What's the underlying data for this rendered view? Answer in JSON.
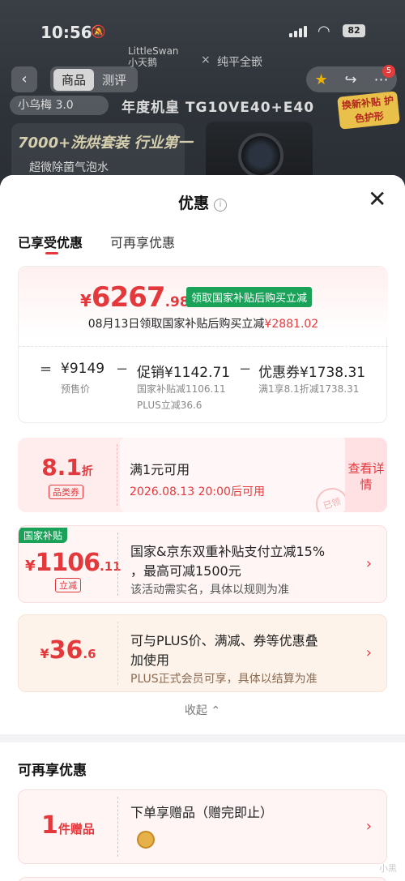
{
  "status_bar": {
    "time": "10:56",
    "battery": "82"
  },
  "background_page": {
    "brand_left": "LittleSwan",
    "brand_left_cn": "小天鹅",
    "brand_x": "×",
    "brand_right": "纯平全嵌",
    "tabs": [
      "商品",
      "测评"
    ],
    "cart_badge": "5",
    "series_tag": "小乌梅 3.0",
    "model_text": "年度机皇 TG10VE40+E40",
    "promo_tag": "换新补贴 护色护形",
    "banner_line1": "7000+洗烘套装 行业第一",
    "banner_line2": "超微除菌气泡水"
  },
  "sheet": {
    "title": "优惠",
    "tabs": [
      "已享受优惠",
      "可再享优惠"
    ],
    "summary": {
      "currency": "¥",
      "price_int": "6267",
      "price_dec": ".98",
      "badge": "领取国家补贴后购买立减",
      "subtitle_prefix": "08月13日领取国家补贴后购买立减",
      "subtitle_amount": "¥2881.02",
      "eq": "=",
      "presale_price": "¥9149",
      "presale_label": "预售价",
      "minus": "−",
      "promo_label_value": "促销¥1142.71",
      "promo_sub1": "国家补贴减1106.11",
      "promo_sub2": "PLUS立减36.6",
      "coupon_label_value": "优惠券¥1738.31",
      "coupon_sub": "满1享8.1折减1738.31"
    },
    "coupon_card": {
      "big": "8.1",
      "big_suffix": "折",
      "tag": "品类券",
      "condition": "满1元可用",
      "time": "2026.08.13 20:00后可用",
      "view_label": "查看详情",
      "stamp": "已领"
    },
    "subsidy_card": {
      "badge": "国家补贴",
      "currency": "¥",
      "amount_int": "1106",
      "amount_dec": ".11",
      "tag": "立减",
      "line1": "国家&京东双重补贴支付立减15%",
      "line2": "，最高可减1500元",
      "line3": "该活动需实名，具体以规则为准"
    },
    "plus_card": {
      "currency": "¥",
      "amount_int": "36",
      "amount_dec": ".6",
      "line1": "可与PLUS价、满减、券等优惠叠",
      "line2": "加使用",
      "line3": "PLUS正式会员可享，具体以结算为准"
    },
    "collapse_label": "收起",
    "section2": {
      "title": "可再享优惠",
      "gift_card": {
        "count": "1",
        "count_suffix": "件赠品",
        "line1": "下单享赠品（赠完即止）"
      }
    },
    "watermark": "小黑"
  },
  "colors": {
    "accent_red": "#e4393c",
    "badge_green": "#1aa259"
  }
}
